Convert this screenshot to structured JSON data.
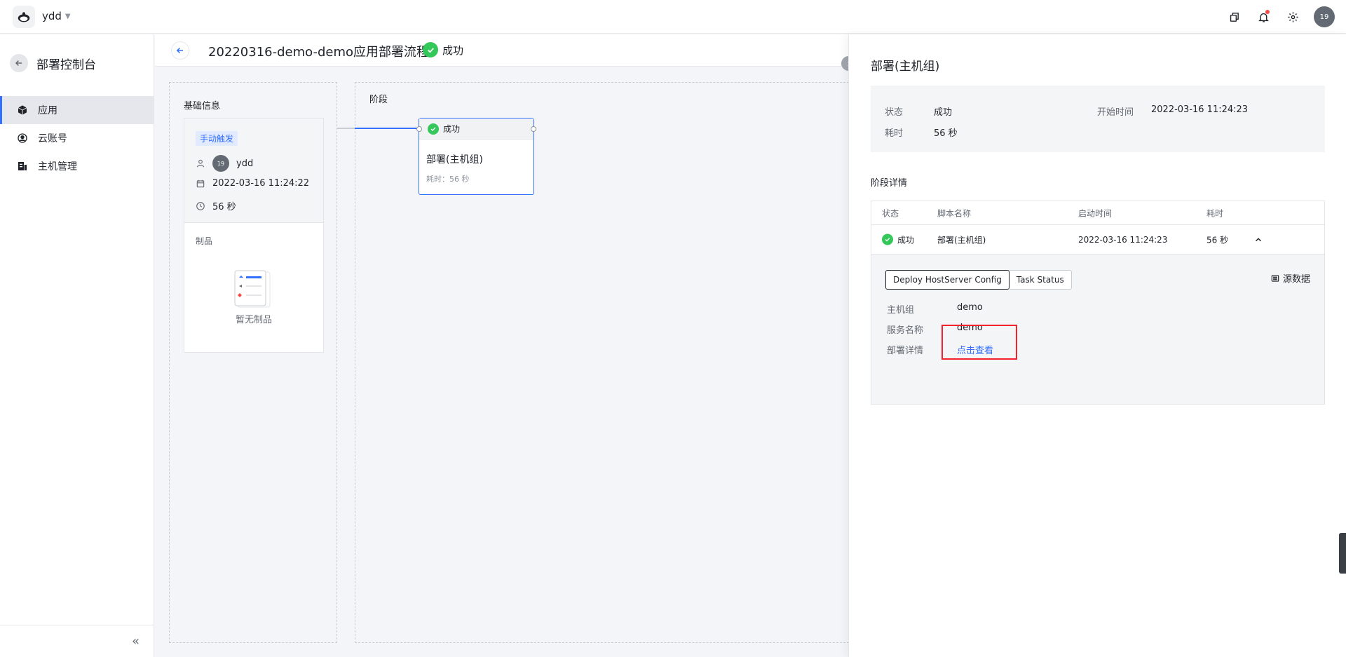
{
  "topbar": {
    "org_name": "ydd",
    "avatar_text": "19",
    "icons": [
      "window-icon",
      "bell-icon",
      "gear-icon"
    ]
  },
  "sidebar": {
    "title": "部署控制台",
    "items": [
      {
        "label": "应用",
        "icon": "cube-icon",
        "active": true
      },
      {
        "label": "云账号",
        "icon": "account-icon",
        "active": false
      },
      {
        "label": "主机管理",
        "icon": "server-icon",
        "active": false
      }
    ],
    "collapse_label": "«"
  },
  "page": {
    "title": "20220316-demo-demo应用部署流程",
    "status": "成功"
  },
  "basic_info": {
    "section_label": "基础信息",
    "trigger": "手动触发",
    "user_avatar": "19",
    "user": "ydd",
    "date": "2022-03-16 11:24:22",
    "duration": "56 秒",
    "artifacts_label": "制品",
    "empty_text": "暂无制品"
  },
  "stage": {
    "section_label": "阶段",
    "card_status": "成功",
    "card_name": "部署(主机组)",
    "card_time": "耗时：56 秒"
  },
  "drawer": {
    "title": "部署(主机组)",
    "summary": {
      "status_label": "状态",
      "status_value": "成功",
      "start_label": "开始时间",
      "start_value": "2022-03-16 11:24:23",
      "duration_label": "耗时",
      "duration_value": "56 秒"
    },
    "section_title": "阶段详情",
    "table": {
      "headers": [
        "状态",
        "脚本名称",
        "启动时间",
        "耗时"
      ],
      "row": {
        "status": "成功",
        "script": "部署(主机组)",
        "start": "2022-03-16 11:24:23",
        "duration": "56 秒"
      }
    },
    "tabs": [
      "Deploy HostServer Config",
      "Task Status"
    ],
    "raw_data_label": "源数据",
    "details": [
      {
        "label": "主机组",
        "value": "demo"
      },
      {
        "label": "服务名称",
        "value": "demo"
      },
      {
        "label": "部署详情",
        "value": "点击查看"
      }
    ]
  },
  "colors": {
    "accent": "#3370ff",
    "success": "#34c759",
    "highlight_box": "#f5222d"
  }
}
